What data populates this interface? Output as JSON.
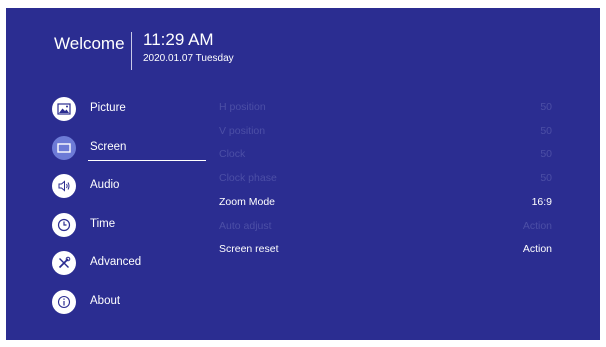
{
  "header": {
    "welcome": "Welcome",
    "time": "11:29 AM",
    "date": "2020.01.07 Tuesday"
  },
  "menu": {
    "items": [
      {
        "label": "Picture",
        "icon": "picture-icon"
      },
      {
        "label": "Screen",
        "icon": "screen-icon",
        "selected": true
      },
      {
        "label": "Audio",
        "icon": "speaker-icon"
      },
      {
        "label": "Time",
        "icon": "clock-icon"
      },
      {
        "label": "Advanced",
        "icon": "tools-icon"
      },
      {
        "label": "About",
        "icon": "info-icon"
      }
    ]
  },
  "settings": {
    "rows": [
      {
        "label": "H position",
        "value": "50",
        "enabled": false
      },
      {
        "label": "V position",
        "value": "50",
        "enabled": false
      },
      {
        "label": "Clock",
        "value": "50",
        "enabled": false
      },
      {
        "label": "Clock phase",
        "value": "50",
        "enabled": false
      },
      {
        "label": "Zoom Mode",
        "value": "16:9",
        "enabled": true
      },
      {
        "label": "Auto adjust",
        "value": "Action",
        "enabled": false
      },
      {
        "label": "Screen reset",
        "value": "Action",
        "enabled": true
      }
    ]
  },
  "colors": {
    "background": "#2b2d91",
    "selected_icon": "#6d7bd6",
    "disabled_text": "#4c4fa6",
    "text": "#ffffff"
  }
}
